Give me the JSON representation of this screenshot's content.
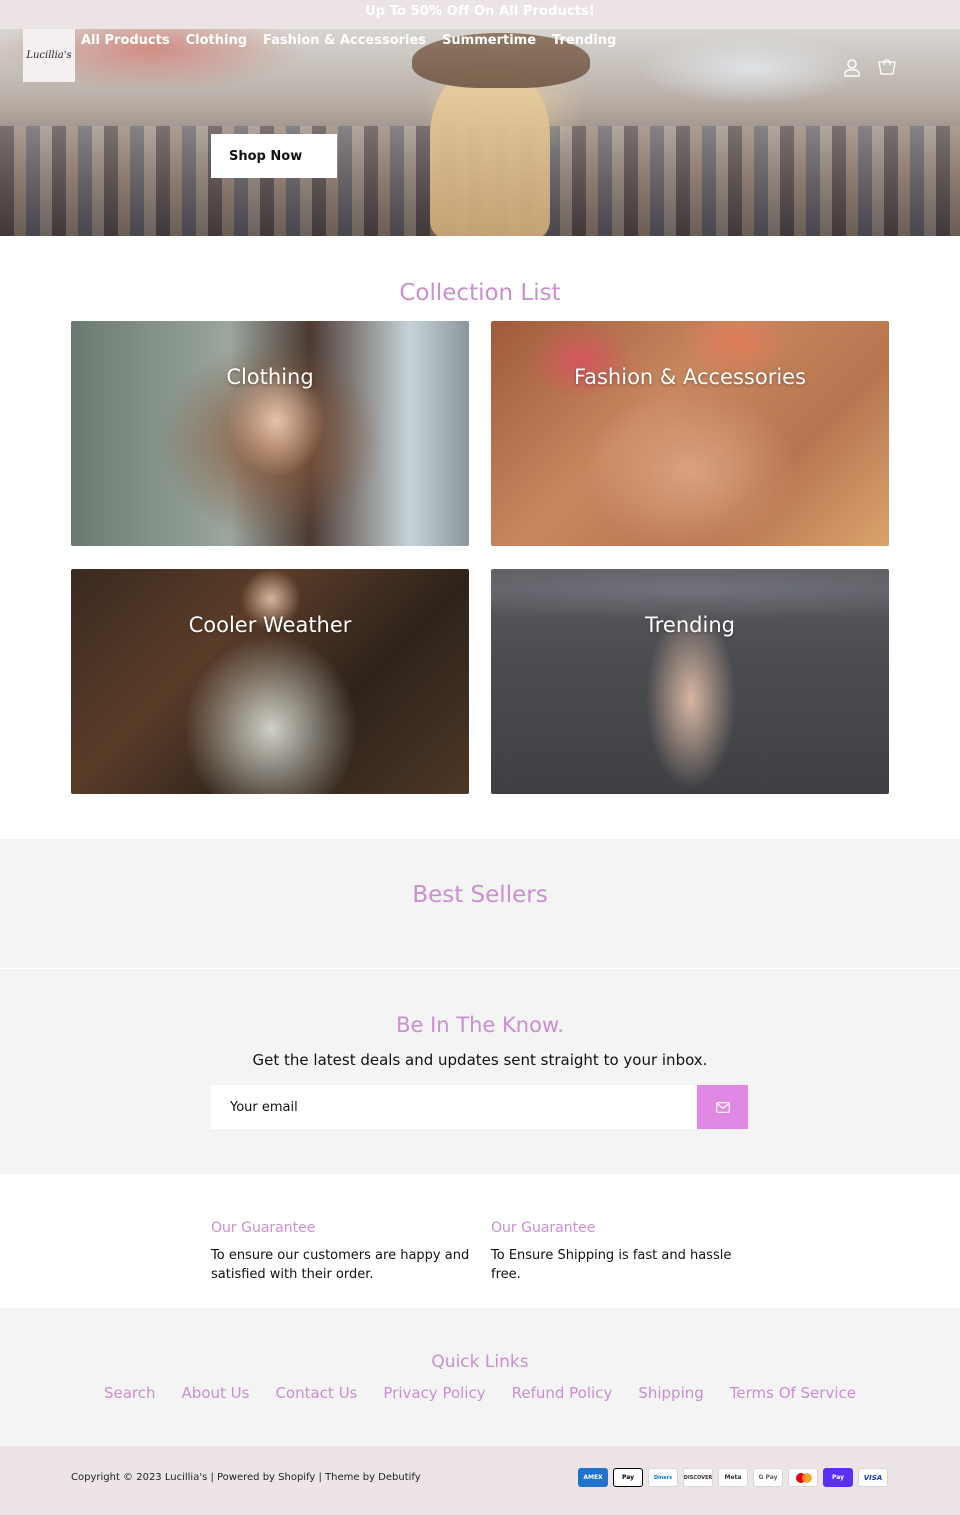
{
  "announcement": "Up To 50% Off On All Products!",
  "logo_text": "Lucillia's",
  "nav": [
    "All Products",
    "Clothing",
    "Fashion & Accessories",
    "Summertime",
    "Trending"
  ],
  "hero": {
    "button": "Shop Now"
  },
  "collection": {
    "title": "Collection List",
    "tiles": [
      "Clothing",
      "Fashion & Accessories",
      "Cooler Weather",
      "Trending"
    ]
  },
  "best_sellers": {
    "title": "Best Sellers"
  },
  "newsletter": {
    "title": "Be In The Know.",
    "subtitle": "Get the latest deals and updates sent straight to your inbox.",
    "placeholder": "Your email"
  },
  "guarantees": [
    {
      "title": "Our Guarantee",
      "text": "To ensure our customers are happy and satisfied with their order."
    },
    {
      "title": "Our Guarantee",
      "text": "To Ensure Shipping is fast and hassle free."
    }
  ],
  "quick_links": {
    "title": "Quick Links",
    "items": [
      "Search",
      "About Us",
      "Contact Us",
      "Privacy Policy",
      "Refund Policy",
      "Shipping",
      "Terms Of Service"
    ]
  },
  "footer": {
    "copyright": "Copyright © 2023 Lucillia's | Powered by Shopify | Theme by Debutify",
    "payments": [
      "AMEX",
      "Pay",
      "Diners",
      "DISCOVER",
      "Meta",
      "G Pay",
      "Mastercard",
      "Pay",
      "VISA"
    ]
  },
  "colors": {
    "accent": "#c98fce",
    "button": "#e088e4",
    "band": "#f4f4f4",
    "footer": "#ede5e5"
  },
  "icons": [
    "account-icon",
    "cart-icon",
    "mail-icon"
  ]
}
